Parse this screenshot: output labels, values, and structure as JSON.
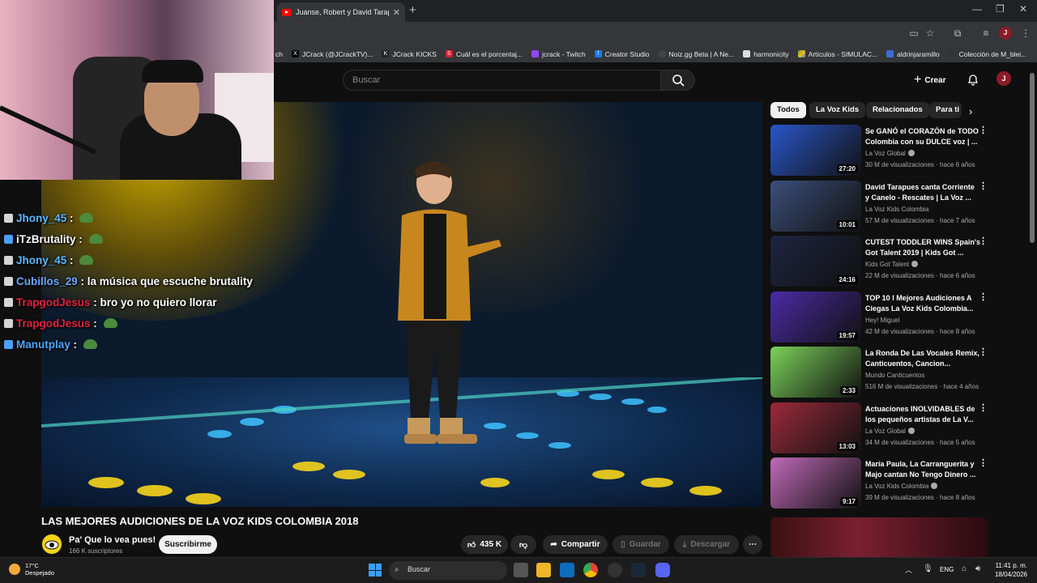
{
  "browser": {
    "tab_title": "Juanse, Robert y David Tarapues",
    "bookmarks": [
      "ch",
      "JCrack (@JCrackTV)...",
      "JCrack KICKS",
      "Cuál es el porcentaj...",
      "jcrack - Twitch",
      "Creator Studio",
      "Noiz.gg Beta | A Ne...",
      "harmonicity",
      "Artículos - SIMULAC...",
      "aldrinjaramillo",
      "Colección de M_blei..."
    ]
  },
  "youtube": {
    "search_placeholder": "Buscar",
    "create_label": "Crear",
    "video_title": "LAS MEJORES AUDICIONES DE LA VOZ KIDS COLOMBIA 2018",
    "channel_name": "Pa' Que lo vea pues!",
    "subscribers": "166 K suscriptores",
    "subscribe_label": "Suscribirme",
    "likes": "435 K",
    "share_label": "Compartir",
    "save_label": "Guardar",
    "download_label": "Descargar",
    "chips": [
      "Todos",
      "La Voz Kids",
      "Relacionados",
      "Para ti"
    ],
    "recommendations": [
      {
        "title": "Se GANÓ el CORAZÓN de TODO Colombia con su DULCE voz | ...",
        "channel": "La Voz Global",
        "verified": true,
        "meta": "30 M de visualizaciones · hace 6 años",
        "duration": "27:20",
        "color": "#2a56c9"
      },
      {
        "title": "David Tarapues canta Corriente y Canelo - Rescates | La Voz ...",
        "channel": "La Voz Kids Colombia",
        "verified": false,
        "meta": "57 M de visualizaciones · hace 7 años",
        "duration": "10:01",
        "color": "#3b4f7a"
      },
      {
        "title": "CUTEST TODDLER WINS Spain's Got Talent 2019 | Kids Got ...",
        "channel": "Kids Got Talent",
        "verified": true,
        "meta": "22 M de visualizaciones · hace 6 años",
        "duration": "24:16",
        "color": "#1d2440"
      },
      {
        "title": "TOP 10 l Mejores Audiciones A Ciegas   La Voz Kids Colombia...",
        "channel": "Hey! Miguel",
        "verified": false,
        "meta": "42 M de visualizaciones · hace 8 años",
        "duration": "19:57",
        "color": "#4a2ba5"
      },
      {
        "title": "La Ronda De Las Vocales Remix, Canticuentos, Cancion...",
        "channel": "Mundo Canticuentos",
        "verified": false,
        "meta": "516 M de visualizaciones · hace 4 años",
        "duration": "2:33",
        "color": "#7bd25a"
      },
      {
        "title": "Actuaciones INOLVIDABLES de los pequeños artistas de La V...",
        "channel": "La Voz Global",
        "verified": true,
        "meta": "34 M de visualizaciones · hace 5 años",
        "duration": "13:03",
        "color": "#9b2a3a"
      },
      {
        "title": "María Paula, La Carranguerita y Majo cantan No Tengo Dinero ...",
        "channel": "La Voz Kids Colombia",
        "verified": true,
        "meta": "39 M de visualizaciones · hace 8 años",
        "duration": "9:17",
        "color": "#c06ab8"
      }
    ]
  },
  "chat": [
    {
      "user": "Jhony_45",
      "text": "",
      "user_color": "#5ab9ff",
      "emote": true
    },
    {
      "user": "iTzBrutality",
      "text": "",
      "user_color": "#ffffff",
      "emote": true
    },
    {
      "user": "Jhony_45",
      "text": "",
      "user_color": "#5ab9ff",
      "emote": true
    },
    {
      "user": "Cubillos_29",
      "text": "la música que escuche brutality",
      "user_color": "#6aa7ff",
      "emote": false
    },
    {
      "user": "TrapgodJesus",
      "text": "bro yo no quiero llorar",
      "user_color": "#e0243e",
      "emote": false
    },
    {
      "user": "TrapgodJesus",
      "text": "",
      "user_color": "#e0243e",
      "emote": true
    },
    {
      "user": "Manutplay",
      "text": "",
      "user_color": "#4da6ff",
      "emote": true
    }
  ],
  "taskbar": {
    "temperature": "17°C",
    "weather": "Despejado",
    "search_label": "Buscar",
    "language": "ENG",
    "time": "11:41 p. m.",
    "date": "18/04/2026"
  }
}
